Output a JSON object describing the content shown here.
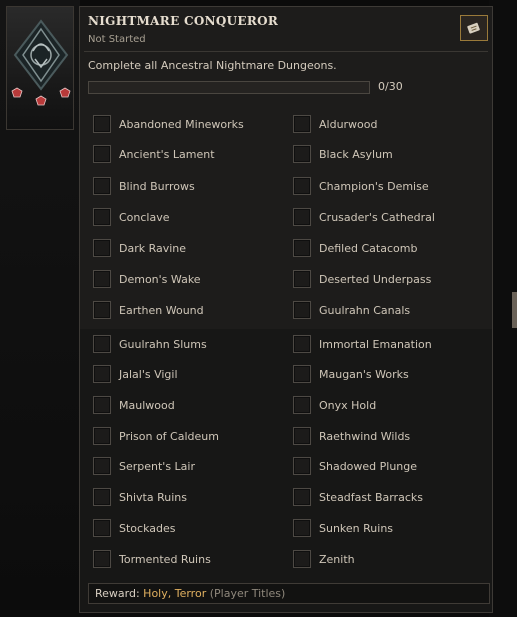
{
  "achievement": {
    "title": "NIGHTMARE CONQUEROR",
    "status": "Not Started",
    "description": "Complete all Ancestral Nightmare Dungeons.",
    "progress": {
      "current": 0,
      "total": 30,
      "text": "0/30"
    },
    "share_icon": "share-icon"
  },
  "dungeons_left": [
    "Abandoned Mineworks",
    "Ancient's Lament",
    "Blind Burrows",
    "Conclave",
    "Dark Ravine",
    "Demon's Wake",
    "Earthen Wound",
    "Guulrahn Slums",
    "Jalal's Vigil",
    "Maulwood",
    "Prison of Caldeum",
    "Serpent's Lair",
    "Shivta Ruins",
    "Stockades",
    "Tormented Ruins"
  ],
  "dungeons_right": [
    "Aldurwood",
    "Black Asylum",
    "Champion's Demise",
    "Crusader's Cathedral",
    "Defiled Catacomb",
    "Deserted Underpass",
    "Guulrahn Canals",
    "Immortal Emanation",
    "Maugan's Works",
    "Onyx Hold",
    "Raethwind Wilds",
    "Shadowed Plunge",
    "Steadfast Barracks",
    "Sunken Ruins",
    "Zenith"
  ],
  "reward": {
    "label": "Reward:",
    "value": "Holy, Terror",
    "note": "(Player Titles)"
  },
  "colors": {
    "accent": "#e0b060",
    "panel": "#1d1c1b",
    "text": "#cfc6b8"
  }
}
